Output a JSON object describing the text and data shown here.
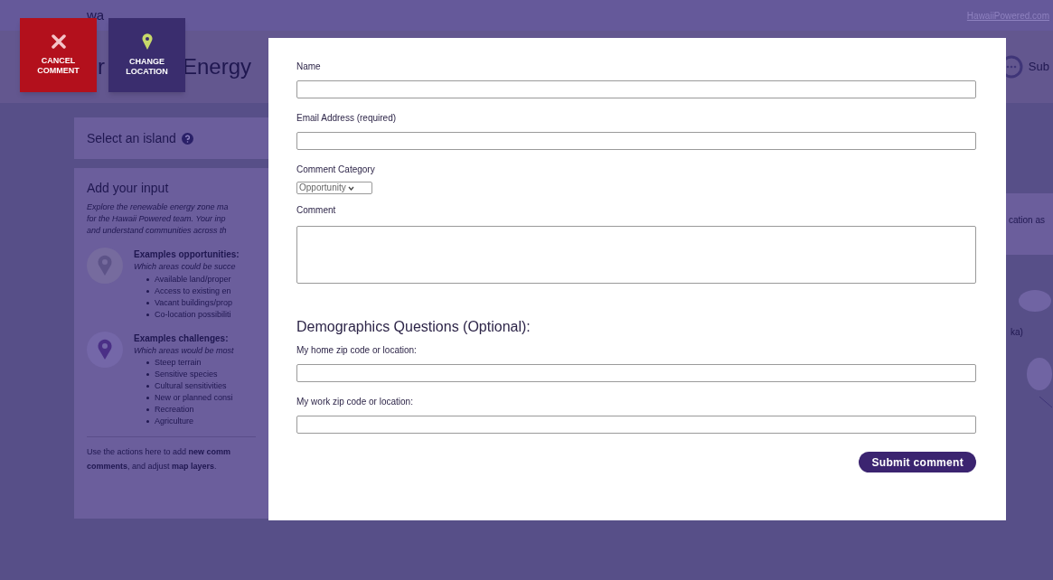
{
  "backdrop": {
    "brand_fragment": "wa",
    "site_link": "HawaiiPowered.com",
    "title_fragments": [
      "r",
      "Energy"
    ],
    "right_button": "Sub",
    "right_fragments": [
      "cation as",
      "ka)"
    ]
  },
  "actions": [
    {
      "kind": "cancel",
      "label": "CANCEL COMMENT"
    },
    {
      "kind": "location",
      "label": "CHANGE LOCATION"
    }
  ],
  "panel": {
    "select_island": "Select an island",
    "title": "Add your input",
    "intro": [
      "Explore the renewable energy zone ma",
      "for the Hawaii Powered team. Your inp",
      "and understand communities across th"
    ],
    "examples": [
      {
        "kind": "opportunity",
        "title": "Examples opportunities:",
        "subtitle": "Which areas could be succe",
        "items": [
          "Available land/proper",
          "Access to existing en",
          "Vacant buildings/prop",
          "Co-location possibiliti"
        ]
      },
      {
        "kind": "challenge",
        "title": "Examples challenges:",
        "subtitle": "Which areas would be most",
        "items": [
          "Steep terrain",
          "Sensitive species",
          "Cultural sensitivities",
          "New or planned consi",
          "Recreation",
          "Agriculture"
        ]
      }
    ],
    "footer": [
      "Use the actions here to add **new comm**",
      "**comments**, and adjust **map layers**."
    ]
  },
  "form": {
    "fields": [
      {
        "kind": "text",
        "label": "Name"
      },
      {
        "kind": "text",
        "label": "Email Address (required)"
      },
      {
        "kind": "select",
        "label": "Comment Category",
        "value": "Opportunity"
      },
      {
        "kind": "textarea",
        "label": "Comment"
      },
      {
        "kind": "heading",
        "label": "Demographics Questions (Optional):"
      },
      {
        "kind": "text",
        "label": "My home zip code or location:"
      },
      {
        "kind": "text",
        "label": "My work zip code or location:"
      }
    ],
    "submit": "Submit comment"
  }
}
